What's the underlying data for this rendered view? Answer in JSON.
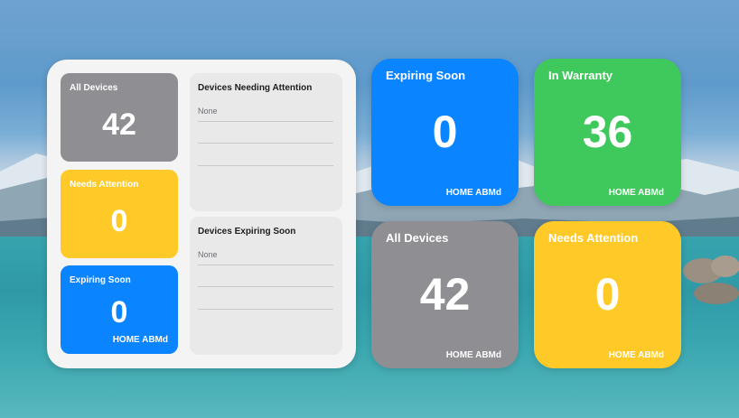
{
  "desktop": {
    "wallpaper": "lake-mountains"
  },
  "large_widget": {
    "tiles": [
      {
        "title": "All Devices",
        "value": "42",
        "color": "#8e8e93",
        "footer": ""
      },
      {
        "title": "Needs Attention",
        "value": "0",
        "color": "#ffca28",
        "footer": ""
      },
      {
        "title": "Expiring Soon",
        "value": "0",
        "color": "#0a84ff",
        "footer": "HOME ABMd"
      }
    ],
    "lists": [
      {
        "title": "Devices Needing Attention",
        "rows": [
          "None",
          "",
          ""
        ]
      },
      {
        "title": "Devices Expiring Soon",
        "rows": [
          "None",
          "",
          ""
        ]
      }
    ]
  },
  "widgets": [
    {
      "title": "Expiring Soon",
      "value": "0",
      "footer": "HOME ABMd",
      "color": "#0a84ff"
    },
    {
      "title": "In Warranty",
      "value": "36",
      "footer": "HOME ABMd",
      "color": "#3fc85b"
    },
    {
      "title": "All Devices",
      "value": "42",
      "footer": "HOME ABMd",
      "color": "#8e8e93"
    },
    {
      "title": "Needs Attention",
      "value": "0",
      "footer": "HOME ABMd",
      "color": "#ffca28"
    }
  ]
}
